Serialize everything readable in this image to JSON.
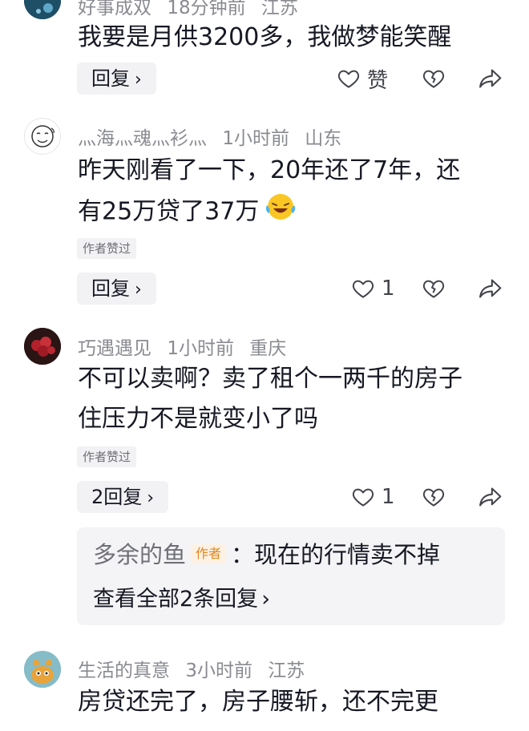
{
  "comments": [
    {
      "username": "好事成双",
      "time": "18分钟前",
      "location": "江苏",
      "text": "我要是月供3200多，我做梦能笑醒",
      "reply_label": "回复",
      "like_label": "赞"
    },
    {
      "username": "灬海灬魂灬衫灬",
      "time": "1小时前",
      "location": "山东",
      "text_line1": "昨天刚看了一下，20年还了7年，还",
      "text_line2": "有25万贷了37万",
      "author_liked": "作者赞过",
      "reply_label": "回复",
      "like_count": "1"
    },
    {
      "username": "巧遇遇见",
      "time": "1小时前",
      "location": "重庆",
      "text_line1": "不可以卖啊？卖了租个一两千的房子",
      "text_line2": "住压力不是就变小了吗",
      "author_liked": "作者赞过",
      "reply_label": "2回复",
      "like_count": "1",
      "sub_reply": {
        "name": "多余的鱼",
        "tag": "作者",
        "text": "：现在的行情卖不掉",
        "view_all": "查看全部2条回复"
      }
    },
    {
      "username": "生活的真意",
      "time": "3小时前",
      "location": "江苏",
      "text_line1": "房贷还完了，房子腰斩，还不完更"
    }
  ],
  "icons": {
    "chevron": "›",
    "heart": "heart-icon",
    "broken_heart": "dislike-heart-icon",
    "share": "share-icon",
    "emoji": "laughing-tears-emoji"
  },
  "colors": {
    "meta": "#8a8b91",
    "text": "#161823",
    "chip_bg": "#f2f2f4",
    "author_tag": "#e0871f"
  }
}
